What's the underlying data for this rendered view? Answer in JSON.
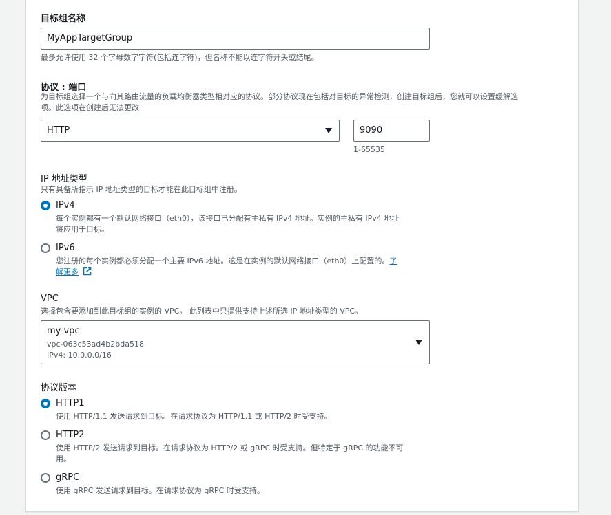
{
  "target_group_name": {
    "label": "目标组名称",
    "value": "MyAppTargetGroup",
    "hint": "最多允许使用 32 个字母数字字符(包括连字符)，但名称不能以连字符开头或结尾。"
  },
  "protocol_port": {
    "label": "协议 : 端口",
    "desc_line1": "为目标组选择一个与向其路由流量的负载均衡器类型相对应的协议。部分协议现在包括对目标的异常检测，创建目标组后，您就可以设置缓解选",
    "desc_line2": "项。此选项在创建后无法更改",
    "protocol": "HTTP",
    "port": "9090",
    "port_hint": "1-65535"
  },
  "ip_type": {
    "label": "IP 地址类型",
    "desc": "只有具备所指示 IP 地址类型的目标才能在此目标组中注册。",
    "options": [
      {
        "label": "IPv4",
        "desc_line1": "每个实例都有一个默认网络接口（eth0），该接口已分配有主私有 IPv4 地址。实例的主私有 IPv4 地址",
        "desc_line2": "将应用于目标。",
        "selected": true
      },
      {
        "label": "IPv6",
        "desc_line1": "您注册的每个实例都必须分配一个主要 IPv6 地址。这是在实例的默认网络接口（eth0）上配置的。",
        "link_part1": "了",
        "link_part2": "解更多",
        "selected": false
      }
    ]
  },
  "vpc": {
    "label": "VPC",
    "desc": "选择包含要添加到此目标组的实例的 VPC。 此列表中只提供支持上述所选 IP 地址类型的 VPC。",
    "name": "my-vpc",
    "id": "vpc-063c53ad4b2bda518",
    "cidr": "IPv4: 10.0.0.0/16"
  },
  "protocol_version": {
    "label": "协议版本",
    "options": [
      {
        "label": "HTTP1",
        "desc_line1": "使用 HTTP/1.1 发送请求到目标。在请求协议为 HTTP/1.1 或 HTTP/2 时受支持。",
        "selected": true
      },
      {
        "label": "HTTP2",
        "desc_line1": "使用 HTTP/2 发送请求到目标。在请求协议为 HTTP/2 或 gRPC 时受支持。但特定于 gRPC 的功能不可",
        "desc_line2": "用。",
        "selected": false
      },
      {
        "label": "gRPC",
        "desc_line1": "使用 gRPC 发送请求到目标。在请求协议为 gRPC 时受支持。",
        "selected": false
      }
    ]
  },
  "colors": {
    "accent": "#0073bb",
    "border": "#687078",
    "text": "#16191f",
    "muted": "#545b64"
  },
  "icons": {
    "select_caret": "caret-down-icon",
    "external": "external-link-icon"
  }
}
